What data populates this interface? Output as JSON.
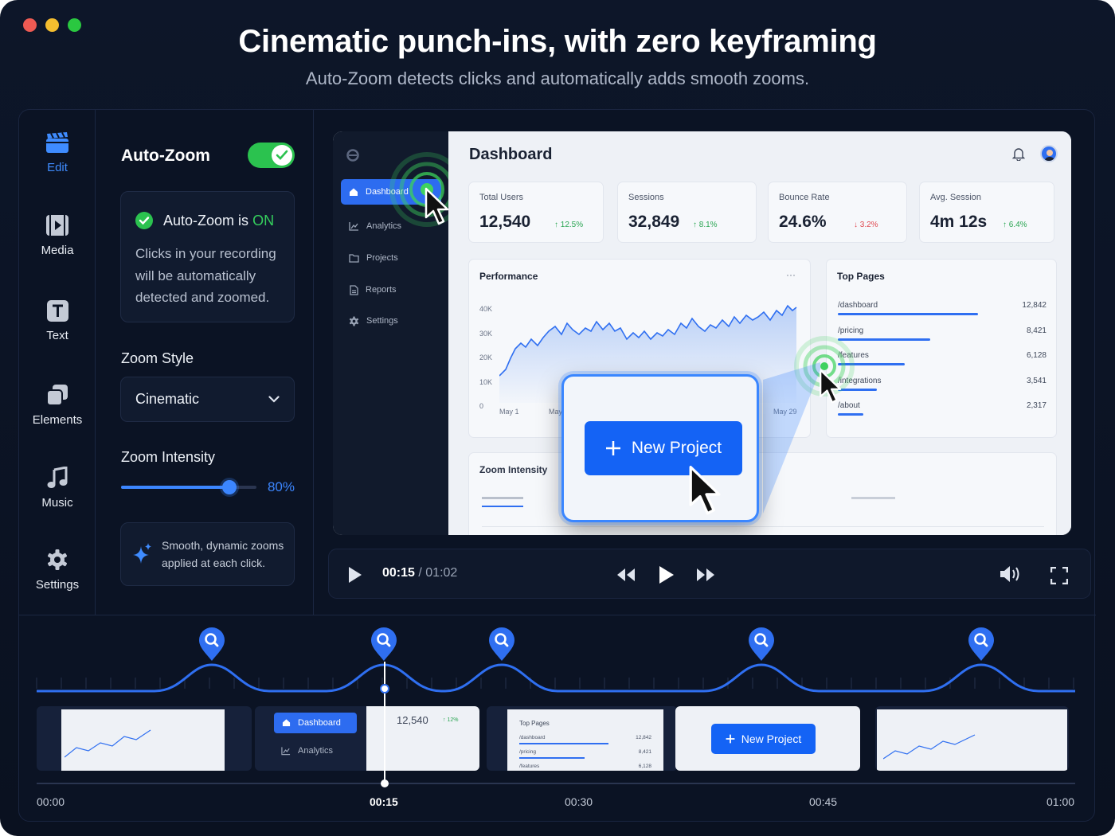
{
  "window": {
    "traffic_lights": [
      "#ed5a53",
      "#f4bd2f",
      "#2ac840"
    ]
  },
  "hero": {
    "title": "Cinematic punch-ins, with zero keyframing",
    "subtitle": "Auto-Zoom detects clicks and automatically adds smooth zooms."
  },
  "rail": [
    {
      "label": "Edit",
      "icon": "clapperboard-icon",
      "active": true
    },
    {
      "label": "Media",
      "icon": "film-icon",
      "active": false
    },
    {
      "label": "Text",
      "icon": "text-icon",
      "active": false
    },
    {
      "label": "Elements",
      "icon": "elements-icon",
      "active": false
    },
    {
      "label": "Music",
      "icon": "music-note-icon",
      "active": false
    },
    {
      "label": "Settings",
      "icon": "gear-icon",
      "active": false
    }
  ],
  "panel": {
    "title": "Auto-Zoom",
    "toggle_on": true,
    "status_prefix": "Auto-Zoom is",
    "status_value": "ON",
    "status_body": "Clicks in your recording will be automatically detected and zoomed.",
    "zoom_style_label": "Zoom Style",
    "zoom_style_value": "Cinematic",
    "zoom_intensity_label": "Zoom Intensity",
    "zoom_intensity_value": "80%",
    "zoom_intensity_fraction": 0.8,
    "tip": "Smooth, dynamic zooms applied at each click."
  },
  "preview": {
    "nav": [
      {
        "label": "Dashboard",
        "icon": "home-icon",
        "active": true
      },
      {
        "label": "Analytics",
        "icon": "chart-icon",
        "active": false
      },
      {
        "label": "Projects",
        "icon": "folder-icon",
        "active": false
      },
      {
        "label": "Reports",
        "icon": "document-icon",
        "active": false
      },
      {
        "label": "Settings",
        "icon": "gear-icon",
        "active": false
      }
    ],
    "title": "Dashboard",
    "kpis": [
      {
        "label": "Total Users",
        "value": "12,540",
        "delta": "↑ 12.5%",
        "trend": "up"
      },
      {
        "label": "Sessions",
        "value": "32,849",
        "delta": "↑ 8.1%",
        "trend": "up"
      },
      {
        "label": "Bounce Rate",
        "value": "24.6%",
        "delta": "↓ 3.2%",
        "trend": "down"
      },
      {
        "label": "Avg. Session",
        "value": "4m 12s",
        "delta": "↑ 6.4%",
        "trend": "up"
      }
    ],
    "performance": {
      "title": "Performance",
      "menu": "···",
      "y_ticks": [
        "40K",
        "30K",
        "20K",
        "10K",
        "0"
      ],
      "x_ticks": [
        "May 1",
        "May",
        "May 29"
      ]
    },
    "top_pages": {
      "title": "Top Pages",
      "rows": [
        {
          "path": "/dashboard",
          "count": "12,842",
          "share": 1.0
        },
        {
          "path": "/pricing",
          "count": "8,421",
          "share": 0.66
        },
        {
          "path": "/features",
          "count": "6,128",
          "share": 0.48
        },
        {
          "path": "/integrations",
          "count": "3,541",
          "share": 0.28
        },
        {
          "path": "/about",
          "count": "2,317",
          "share": 0.18
        }
      ]
    },
    "zoom_card": {
      "title": "Zoom Intensity"
    },
    "new_project": "New Project"
  },
  "player": {
    "current": "00:15",
    "total": "/ 01:02"
  },
  "timeline": {
    "labels": [
      "00:00",
      "00:15",
      "00:30",
      "00:45",
      "01:00"
    ],
    "thumb_dashboard": "Dashboard",
    "thumb_analytics": "Analytics",
    "thumb_value": "12,540",
    "thumb_delta": "↑ 12%",
    "thumb_top_pages": "Top Pages",
    "thumb_rows": [
      {
        "path": "/dashboard",
        "count": "12,842"
      },
      {
        "path": "/pricing",
        "count": "8,421"
      },
      {
        "path": "/features",
        "count": "6,128"
      }
    ],
    "thumb_new_project": "New Project"
  }
}
